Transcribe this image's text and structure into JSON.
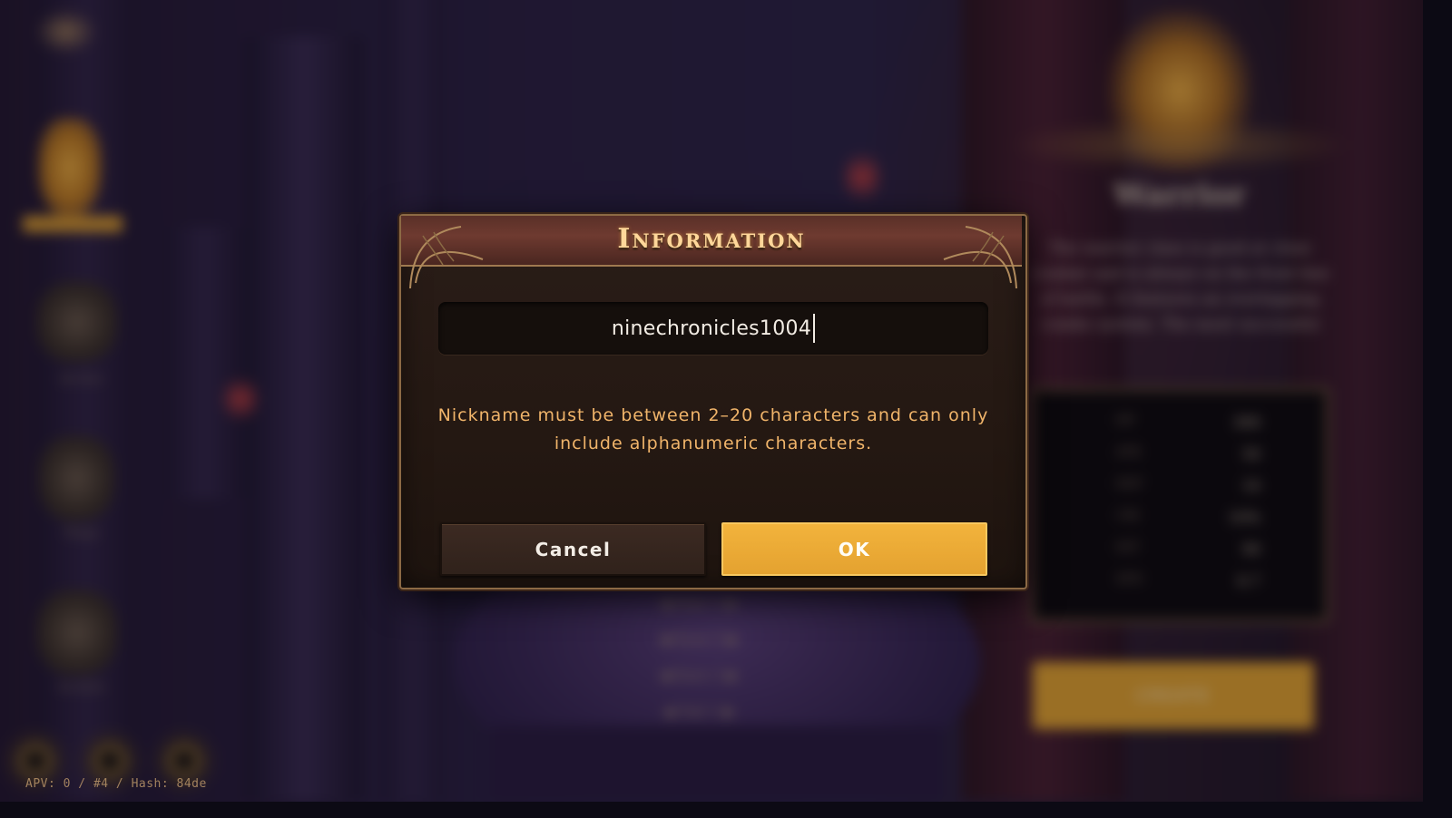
{
  "dialog": {
    "title": "Information",
    "nickname_value": "ninechronicles1004",
    "message": "Nickname must be between 2–20 characters and can only include alphanumeric characters.",
    "cancel_label": "Cancel",
    "ok_label": "OK"
  },
  "footer": {
    "status_text": "APV: 0 / #4 / Hash: 84de"
  },
  "background": {
    "character_class_title": "Warrior",
    "class_description": "The warrior class is good at close combat and is always on the front line of battle. It features an overlapping combo system. The most successful",
    "stats": [
      {
        "label": "HP",
        "value": "300"
      },
      {
        "label": "ATK",
        "value": "50"
      },
      {
        "label": "DEF",
        "value": "10"
      },
      {
        "label": "CRI",
        "value": "10%"
      },
      {
        "label": "HIT",
        "value": "90"
      },
      {
        "label": "SPD",
        "value": "6.7"
      }
    ],
    "create_label": "CREATE",
    "appearance_options": [
      "Hair 1",
      "Eyes 1",
      "Ears 1",
      "Tail 1"
    ],
    "class_menu": [
      "Warrior",
      "Archer",
      "Mage",
      "Acolyte"
    ]
  },
  "colors": {
    "accent_gold": "#e8a830",
    "message_orange": "#f0b46a",
    "title_gold": "#ffd79a",
    "dialog_header": "#6e3a30"
  }
}
